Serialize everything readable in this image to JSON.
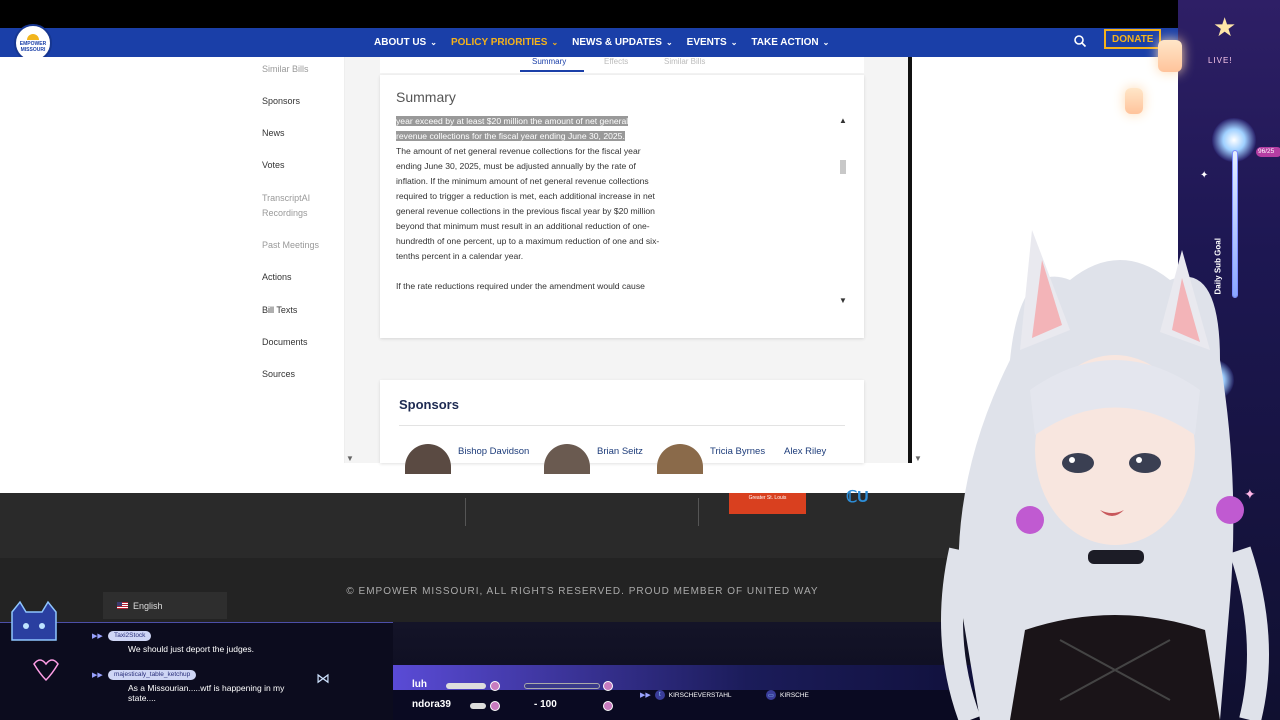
{
  "nav": {
    "logo_text": "EMPOWER MISSOURI",
    "items": [
      {
        "label": "ABOUT US",
        "chev": "⌄"
      },
      {
        "label": "POLICY PRIORITIES",
        "chev": "⌄"
      },
      {
        "label": "NEWS & UPDATES",
        "chev": "⌄"
      },
      {
        "label": "EVENTS",
        "chev": "⌄"
      },
      {
        "label": "TAKE ACTION",
        "chev": "⌄"
      }
    ],
    "donate_label": "DONATE"
  },
  "sidebar": {
    "items": [
      {
        "label": "Similar Bills"
      },
      {
        "label": "Sponsors"
      },
      {
        "label": "News"
      },
      {
        "label": "Votes"
      },
      {
        "label": "TranscriptAI Recordings"
      },
      {
        "label": "Past Meetings"
      },
      {
        "label": "Actions"
      },
      {
        "label": "Bill Texts"
      },
      {
        "label": "Documents"
      },
      {
        "label": "Sources"
      }
    ]
  },
  "tabs": {
    "summary": "Summary",
    "second": "Effects",
    "third": "Similar Bills"
  },
  "summary": {
    "title": "Summary",
    "highlighted_1": "year exceed by at least $20 million the amount of net general",
    "highlighted_2": "revenue collections for the fiscal year ending June 30, 2025.",
    "para_1": "The amount of net general revenue collections for the fiscal year ending June 30, 2025, must be adjusted annually by the rate of inflation. If the minimum amount of net general revenue collections required to trigger a reduction is met, each additional increase in net general revenue collections in the previous fiscal year by $20 million beyond that minimum must result in an additional reduction of one-hundredth of one percent, up to a maximum reduction of one and six-tenths percent in a calendar year.",
    "para_2": "If the rate reductions required under the amendment would cause"
  },
  "sponsors": {
    "title": "Sponsors",
    "people": [
      "Bishop Davidson",
      "Brian Seitz",
      "Tricia Byrnes",
      "Alex Riley"
    ]
  },
  "footer": {
    "copyright": "© EMPOWER MISSOURI, ALL RIGHTS RESERVED. PROUD MEMBER OF UNITED WAY",
    "red_logo_text": "Greater St. Louis",
    "blue_logo_text": "ℂU",
    "language": "English"
  },
  "overlay": {
    "live": "LIVE!",
    "daily_goal": "Daily Sub Goal",
    "goal_count": "96/25",
    "chat": [
      {
        "user": "Taxi2Stock",
        "message": "We should just deport the judges."
      },
      {
        "user": "majesticaly_table_ketchup",
        "message": "As a Missourian.....wtf is happening in my state...."
      }
    ],
    "goal_rows": [
      {
        "label": "luh",
        "value": ""
      },
      {
        "label": "ndora39",
        "value": "- 100"
      }
    ],
    "socials": [
      "KIRSCHEVERSTAHL",
      "KIRSCHE"
    ]
  },
  "colors": {
    "nav_bg": "#1a3fa8",
    "nav_active": "#f5b21b",
    "link": "#1d3c7a"
  }
}
